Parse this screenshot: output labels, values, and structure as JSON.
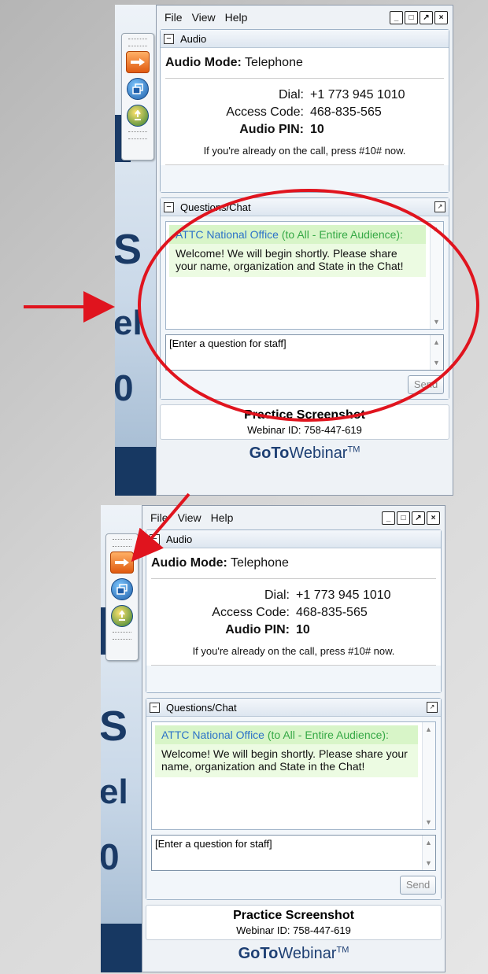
{
  "windows": [
    {
      "menu": [
        "File",
        "View",
        "Help"
      ],
      "audio": {
        "heading": "Audio",
        "mode_label": "Audio Mode:",
        "mode_value": "Telephone",
        "dial_label": "Dial:",
        "dial_value": "+1 773 945 1010",
        "access_label": "Access Code:",
        "access_value": "468-835-565",
        "pin_label": "Audio PIN:",
        "pin_value": "10",
        "note": "If you're already on the call, press #10# now."
      },
      "chat": {
        "heading": "Questions/Chat",
        "sender": "ATTC National Office",
        "recipient": "(to All - Entire Audience):",
        "message": "Welcome!  We will begin shortly.  Please share your name, organization and State in the Chat!",
        "input_value": "[Enter a question for staff]",
        "send_label": "Send"
      },
      "footer": {
        "title": "Practice Screenshot",
        "webinar_id": "Webinar ID: 758-447-619"
      },
      "brand": {
        "go": "GoTo",
        "web": "Webinar",
        "tm": "TM"
      }
    },
    {
      "menu": [
        "File",
        "View",
        "Help"
      ],
      "audio": {
        "heading": "Audio",
        "mode_label": "Audio Mode:",
        "mode_value": "Telephone",
        "dial_label": "Dial:",
        "dial_value": "+1 773 945 1010",
        "access_label": "Access Code:",
        "access_value": "468-835-565",
        "pin_label": "Audio PIN:",
        "pin_value": "10",
        "note": "If you're already on the call, press #10# now."
      },
      "chat": {
        "heading": "Questions/Chat",
        "sender": "ATTC National Office",
        "recipient": "(to All - Entire Audience):",
        "message": "Welcome!  We will begin shortly.  Please share your name, organization and State in the Chat!",
        "input_value": "[Enter a question for staff]",
        "send_label": "Send"
      },
      "footer": {
        "title": "Practice Screenshot",
        "webinar_id": "Webinar ID: 758-447-619"
      },
      "brand": {
        "go": "GoTo",
        "web": "Webinar",
        "tm": "TM"
      }
    }
  ],
  "slide": {
    "letters": [
      "S",
      "el",
      "0"
    ]
  },
  "icons": [
    "arrow-right-icon",
    "window-restore-icon",
    "raise-hand-icon",
    "minimize-icon",
    "maximize-icon",
    "popout-icon",
    "close-icon"
  ],
  "colors": {
    "annotation": "#e0141e",
    "sender": "#2c72c8",
    "message_bg": "#ecfbe2",
    "brand": "#1d3f73"
  }
}
